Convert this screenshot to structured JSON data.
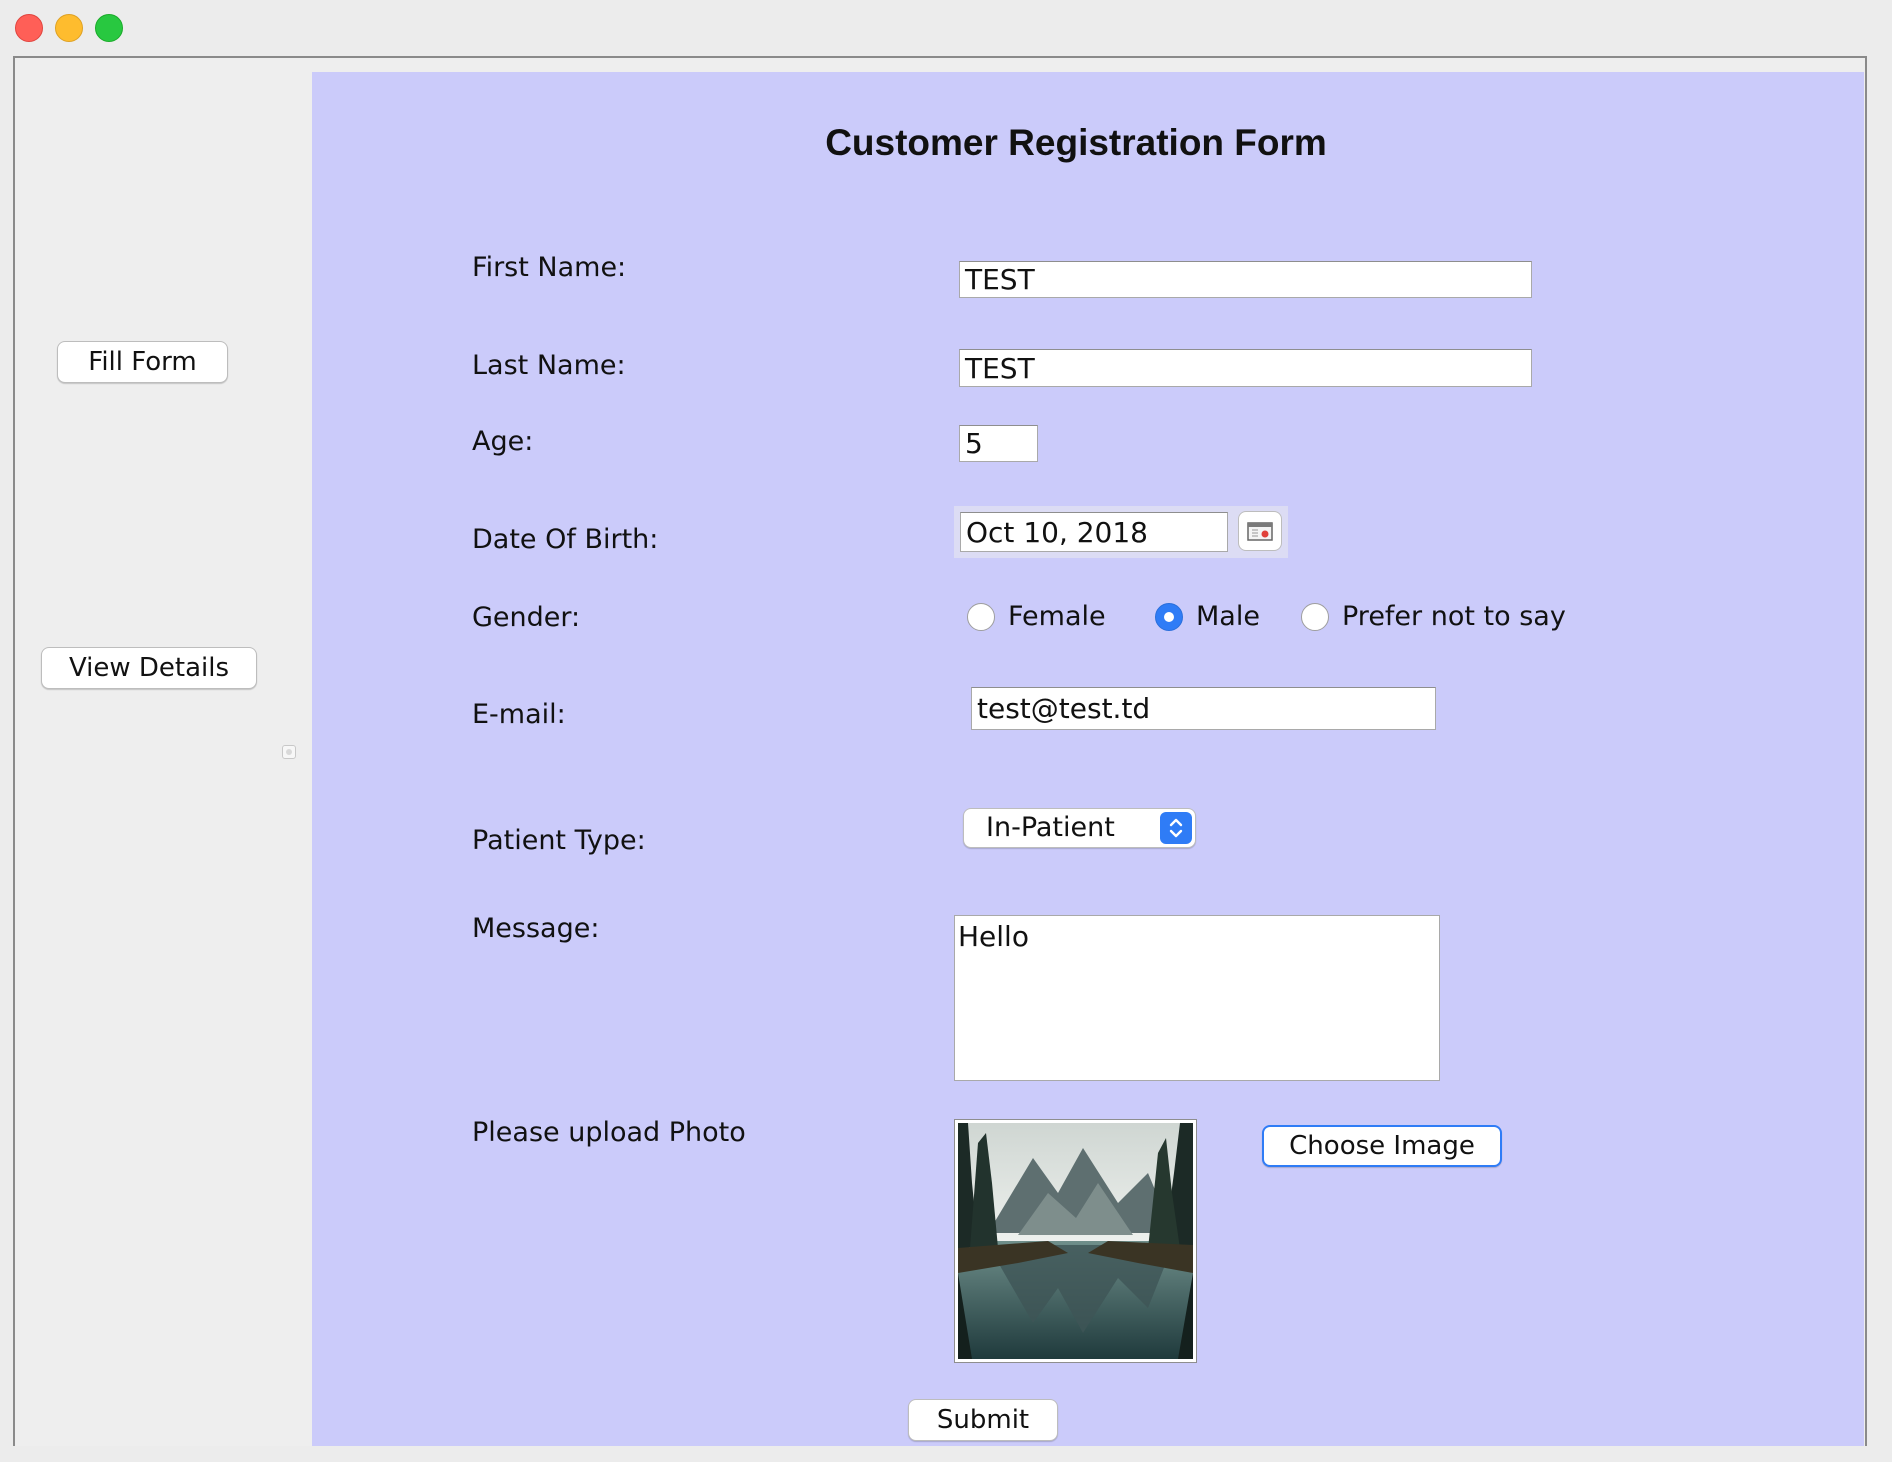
{
  "sidebar": {
    "fill_form_label": "Fill Form",
    "view_details_label": "View Details"
  },
  "form": {
    "title": "Customer Registration Form",
    "first_name": {
      "label": "First Name:",
      "value": "TEST"
    },
    "last_name": {
      "label": "Last Name:",
      "value": "TEST"
    },
    "age": {
      "label": "Age:",
      "value": "5"
    },
    "date_of_birth": {
      "label": "Date Of Birth:",
      "value": "Oct 10, 2018",
      "button_icon": "calendar-icon"
    },
    "gender": {
      "label": "Gender:",
      "options": [
        "Female",
        "Male",
        "Prefer not to say"
      ],
      "selected": "Male"
    },
    "email": {
      "label": "E-mail:",
      "value": "test@test.td"
    },
    "patient_type": {
      "label": "Patient Type:",
      "value": "In-Patient"
    },
    "message": {
      "label": "Message:",
      "value": "Hello"
    },
    "photo": {
      "label": "Please upload Photo",
      "choose_label": "Choose Image"
    },
    "submit_label": "Submit"
  },
  "colors": {
    "form_background": "#cbcbfa",
    "accent": "#2f7cf6",
    "window_background": "#ececec"
  }
}
